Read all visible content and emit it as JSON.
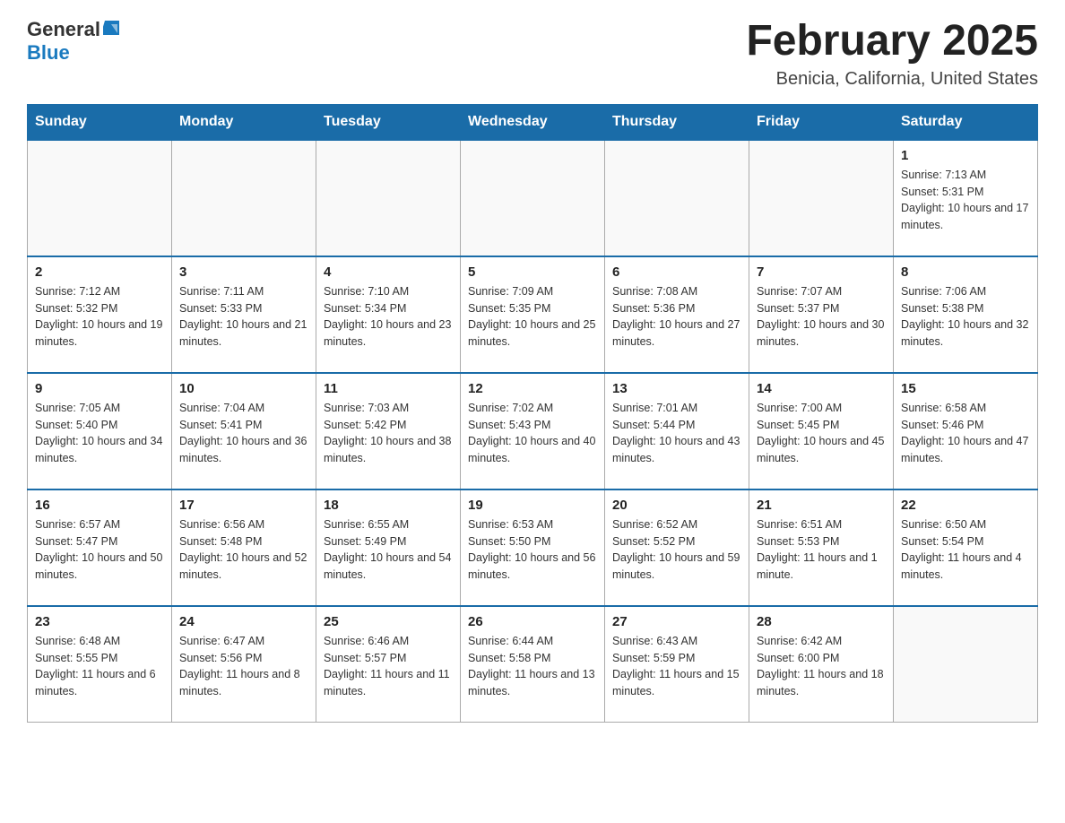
{
  "header": {
    "logo_general": "General",
    "logo_blue": "Blue",
    "month_title": "February 2025",
    "location": "Benicia, California, United States"
  },
  "days_of_week": [
    "Sunday",
    "Monday",
    "Tuesday",
    "Wednesday",
    "Thursday",
    "Friday",
    "Saturday"
  ],
  "weeks": [
    [
      {
        "day": "",
        "info": ""
      },
      {
        "day": "",
        "info": ""
      },
      {
        "day": "",
        "info": ""
      },
      {
        "day": "",
        "info": ""
      },
      {
        "day": "",
        "info": ""
      },
      {
        "day": "",
        "info": ""
      },
      {
        "day": "1",
        "info": "Sunrise: 7:13 AM\nSunset: 5:31 PM\nDaylight: 10 hours and 17 minutes."
      }
    ],
    [
      {
        "day": "2",
        "info": "Sunrise: 7:12 AM\nSunset: 5:32 PM\nDaylight: 10 hours and 19 minutes."
      },
      {
        "day": "3",
        "info": "Sunrise: 7:11 AM\nSunset: 5:33 PM\nDaylight: 10 hours and 21 minutes."
      },
      {
        "day": "4",
        "info": "Sunrise: 7:10 AM\nSunset: 5:34 PM\nDaylight: 10 hours and 23 minutes."
      },
      {
        "day": "5",
        "info": "Sunrise: 7:09 AM\nSunset: 5:35 PM\nDaylight: 10 hours and 25 minutes."
      },
      {
        "day": "6",
        "info": "Sunrise: 7:08 AM\nSunset: 5:36 PM\nDaylight: 10 hours and 27 minutes."
      },
      {
        "day": "7",
        "info": "Sunrise: 7:07 AM\nSunset: 5:37 PM\nDaylight: 10 hours and 30 minutes."
      },
      {
        "day": "8",
        "info": "Sunrise: 7:06 AM\nSunset: 5:38 PM\nDaylight: 10 hours and 32 minutes."
      }
    ],
    [
      {
        "day": "9",
        "info": "Sunrise: 7:05 AM\nSunset: 5:40 PM\nDaylight: 10 hours and 34 minutes."
      },
      {
        "day": "10",
        "info": "Sunrise: 7:04 AM\nSunset: 5:41 PM\nDaylight: 10 hours and 36 minutes."
      },
      {
        "day": "11",
        "info": "Sunrise: 7:03 AM\nSunset: 5:42 PM\nDaylight: 10 hours and 38 minutes."
      },
      {
        "day": "12",
        "info": "Sunrise: 7:02 AM\nSunset: 5:43 PM\nDaylight: 10 hours and 40 minutes."
      },
      {
        "day": "13",
        "info": "Sunrise: 7:01 AM\nSunset: 5:44 PM\nDaylight: 10 hours and 43 minutes."
      },
      {
        "day": "14",
        "info": "Sunrise: 7:00 AM\nSunset: 5:45 PM\nDaylight: 10 hours and 45 minutes."
      },
      {
        "day": "15",
        "info": "Sunrise: 6:58 AM\nSunset: 5:46 PM\nDaylight: 10 hours and 47 minutes."
      }
    ],
    [
      {
        "day": "16",
        "info": "Sunrise: 6:57 AM\nSunset: 5:47 PM\nDaylight: 10 hours and 50 minutes."
      },
      {
        "day": "17",
        "info": "Sunrise: 6:56 AM\nSunset: 5:48 PM\nDaylight: 10 hours and 52 minutes."
      },
      {
        "day": "18",
        "info": "Sunrise: 6:55 AM\nSunset: 5:49 PM\nDaylight: 10 hours and 54 minutes."
      },
      {
        "day": "19",
        "info": "Sunrise: 6:53 AM\nSunset: 5:50 PM\nDaylight: 10 hours and 56 minutes."
      },
      {
        "day": "20",
        "info": "Sunrise: 6:52 AM\nSunset: 5:52 PM\nDaylight: 10 hours and 59 minutes."
      },
      {
        "day": "21",
        "info": "Sunrise: 6:51 AM\nSunset: 5:53 PM\nDaylight: 11 hours and 1 minute."
      },
      {
        "day": "22",
        "info": "Sunrise: 6:50 AM\nSunset: 5:54 PM\nDaylight: 11 hours and 4 minutes."
      }
    ],
    [
      {
        "day": "23",
        "info": "Sunrise: 6:48 AM\nSunset: 5:55 PM\nDaylight: 11 hours and 6 minutes."
      },
      {
        "day": "24",
        "info": "Sunrise: 6:47 AM\nSunset: 5:56 PM\nDaylight: 11 hours and 8 minutes."
      },
      {
        "day": "25",
        "info": "Sunrise: 6:46 AM\nSunset: 5:57 PM\nDaylight: 11 hours and 11 minutes."
      },
      {
        "day": "26",
        "info": "Sunrise: 6:44 AM\nSunset: 5:58 PM\nDaylight: 11 hours and 13 minutes."
      },
      {
        "day": "27",
        "info": "Sunrise: 6:43 AM\nSunset: 5:59 PM\nDaylight: 11 hours and 15 minutes."
      },
      {
        "day": "28",
        "info": "Sunrise: 6:42 AM\nSunset: 6:00 PM\nDaylight: 11 hours and 18 minutes."
      },
      {
        "day": "",
        "info": ""
      }
    ]
  ]
}
